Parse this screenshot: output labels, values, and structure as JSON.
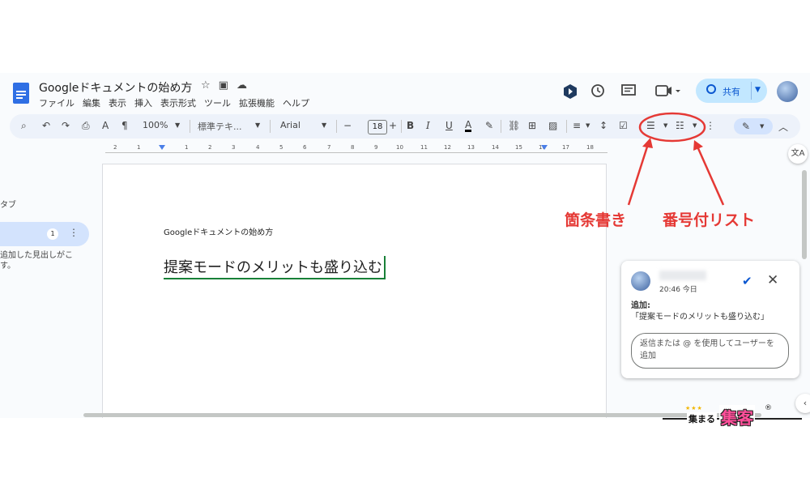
{
  "doc": {
    "title": "Googleドキュメントの始め方",
    "star_icon": "☆",
    "folder_icon": "▣",
    "cloud_icon": "☁"
  },
  "menu": [
    "ファイル",
    "編集",
    "表示",
    "挿入",
    "表示形式",
    "ツール",
    "拡張機能",
    "ヘルプ"
  ],
  "header": {
    "share_label": "共有",
    "icons": [
      "gemini-icon",
      "history-icon",
      "comments-icon",
      "meet-icon"
    ]
  },
  "toolbar": {
    "zoom": "100%",
    "style": "標準テキ...",
    "font": "Arial",
    "font_size": "18",
    "minus": "−",
    "plus": "+",
    "bold": "B",
    "italic": "I",
    "underline": "U",
    "text_color": "A"
  },
  "ruler": {
    "labels": [
      "2",
      "1",
      "1",
      "2",
      "3",
      "4",
      "5",
      "6",
      "7",
      "8",
      "9",
      "10",
      "11",
      "12",
      "13",
      "14",
      "15",
      "16",
      "17",
      "18"
    ]
  },
  "outline": {
    "label": "タブ",
    "badge": "1",
    "hint": "追加した見出しがこ す。"
  },
  "page": {
    "title_text": "Googleドキュメントの始め方",
    "suggested_text": "提案モードのメリットも盛り込む"
  },
  "comment": {
    "time": "20:46 今日",
    "body_label": "追加:",
    "body_text": "「提案モードのメリットも盛り込む」",
    "reply_placeholder": "返信または @ を使用してユーザーを追加"
  },
  "annotations": {
    "bullet_list": "箇条書き",
    "numbered_list": "番号付リスト",
    "color": "#e53935"
  },
  "logo": {
    "small_text": "集まる",
    "big_text": "集客",
    "reg": "®"
  }
}
